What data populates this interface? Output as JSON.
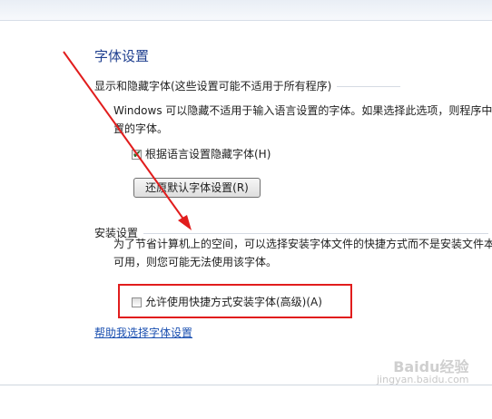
{
  "page": {
    "title": "字体设置"
  },
  "display_group": {
    "header": "显示和隐藏字体(这些设置可能不适用于所有程序)",
    "description_line1": "Windows 可以隐藏不适用于输入语言设置的字体。如果选择此选项，则程序中",
    "description_line2": "置的字体。",
    "checkbox_label": "根据语言设置隐藏字体(H)",
    "checkbox_checked": true,
    "restore_button_label": "还原默认字体设置(R)"
  },
  "install_group": {
    "header": "安装设置",
    "description_line1": "为了节省计算机上的空间，可以选择安装字体文件的快捷方式而不是安装文件本",
    "description_line2": "可用，则您可能无法使用该字体。",
    "checkbox_label": "允许使用快捷方式安装字体(高级)(A)",
    "checkbox_checked": false
  },
  "help_link": "帮助我选择字体设置",
  "annotation": {
    "arrow_color": "#e11d1d",
    "box_color": "#e11d1d"
  },
  "watermark": {
    "main": "Baidu经验",
    "sub": "jingyan.baidu.com"
  },
  "colors": {
    "title": "#1f3f8f",
    "link": "#1a4fb0",
    "text": "#1e1e1e"
  }
}
